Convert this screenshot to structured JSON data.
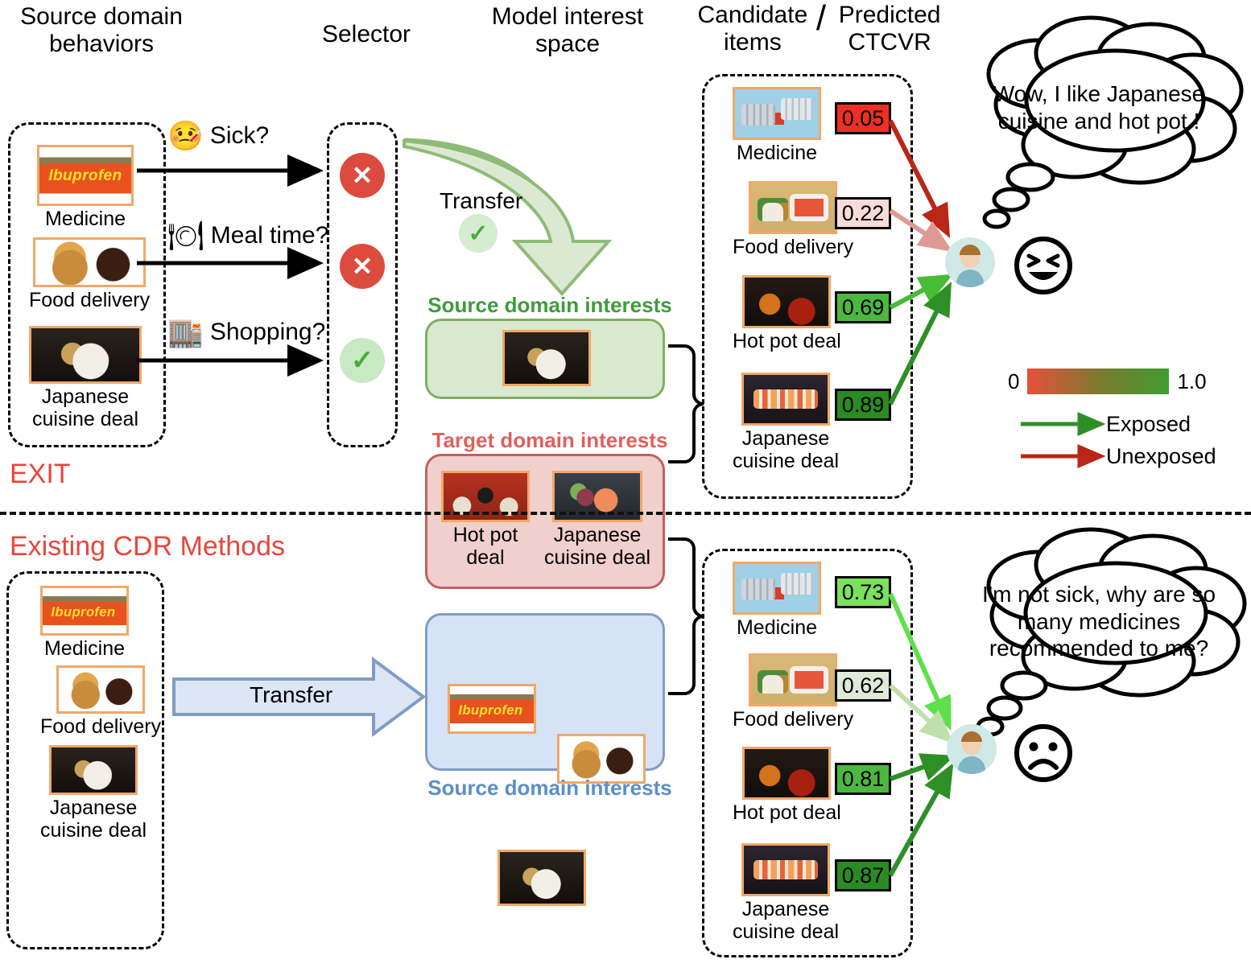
{
  "headers": {
    "source_behaviors": "Source domain\nbehaviors",
    "selector": "Selector",
    "model_interest_space": "Model interest\nspace",
    "candidate_ctcvr": "Candidate  /  Predicted\nitems         CTCVR",
    "candidate_line1": "Candidate",
    "candidate_line2": "items",
    "predicted_line1": "Predicted",
    "predicted_line2": "CTCVR"
  },
  "sections": {
    "top_label": "EXIT",
    "bottom_label": "Existing CDR Methods"
  },
  "top": {
    "behaviors": [
      {
        "label": "Medicine",
        "image": "medicine-box"
      },
      {
        "label": "Food delivery",
        "image": "burger-and-soda"
      },
      {
        "label": "Japanese\ncuisine deal",
        "image": "sashimi-plate"
      }
    ],
    "behavior_labels": [
      "Medicine",
      "Food delivery",
      "Japanese",
      "cuisine deal"
    ],
    "selector": {
      "questions": [
        {
          "text": "Sick?",
          "icon": "sick-person-icon",
          "decision": "reject"
        },
        {
          "text": "Meal time?",
          "icon": "person-eating-icon",
          "decision": "reject"
        },
        {
          "text": "Shopping?",
          "icon": "mall-building-icon",
          "decision": "accept"
        }
      ],
      "reject_symbol": "✕",
      "accept_symbol": "✓"
    },
    "transfer": {
      "label": "Transfer",
      "status": "accept",
      "symbol": "✓"
    },
    "source_interests": {
      "title": "Source domain interests",
      "color": "#3f9c3a",
      "items": [
        {
          "label": "",
          "image": "sashimi-plate"
        }
      ]
    },
    "target_interests": {
      "title": "Target domain interests",
      "color": "#e0605e",
      "items": [
        {
          "label": "Hot pot\ndeal",
          "image": "hotpot-spread"
        },
        {
          "label": "Japanese\ncuisine deal",
          "image": "sashimi-platter"
        }
      ],
      "labels": [
        "Hot pot",
        "deal",
        "Japanese",
        "cuisine deal"
      ]
    },
    "candidates": [
      {
        "label": "Medicine",
        "image": "pills-tray",
        "score": "0.05",
        "chip_bg": "#ee2f22",
        "arrow": "unexposed",
        "arrow_color": "#b92717"
      },
      {
        "label": "Food delivery",
        "image": "bento-box",
        "score": "0.22",
        "chip_bg": "#f7dbd8",
        "arrow": "unexposed",
        "arrow_color": "#dd9a94"
      },
      {
        "label": "Hot pot deal",
        "image": "hotpot-dish",
        "score": "0.69",
        "chip_bg": "#4cb83f",
        "arrow": "exposed",
        "arrow_color": "#49bb36"
      },
      {
        "label": "Japanese\ncuisine deal",
        "image": "sushi-platter",
        "score": "0.89",
        "chip_bg": "#2a8b22",
        "arrow": "exposed",
        "arrow_color": "#2f8f27"
      }
    ],
    "candidate_labels": [
      "Medicine",
      "Food delivery",
      "Hot pot deal",
      "Japanese",
      "cuisine deal"
    ],
    "thought": "Wow, I like Japanese cuisine and hot pot !",
    "thought_lines": [
      "Wow, I like Japanese",
      "cuisine and hot pot !"
    ],
    "user_icon": "user-avatar",
    "emoji": "happy-face"
  },
  "bottom": {
    "behaviors": [
      {
        "label": "Medicine",
        "image": "medicine-box"
      },
      {
        "label": "Food delivery",
        "image": "burger-and-soda"
      },
      {
        "label": "Japanese\ncuisine deal",
        "image": "sashimi-plate"
      }
    ],
    "behavior_labels": [
      "Medicine",
      "Food delivery",
      "Japanese",
      "cuisine deal"
    ],
    "transfer": {
      "label": "Transfer"
    },
    "source_interests": {
      "title": "Source domain interests",
      "color": "#5b8ec9",
      "items": [
        {
          "image": "medicine-box"
        },
        {
          "image": "burger-and-soda"
        },
        {
          "image": "sashimi-plate"
        }
      ]
    },
    "candidates": [
      {
        "label": "Medicine",
        "image": "pills-tray",
        "score": "0.73",
        "chip_bg": "#7ae05e",
        "arrow": "exposed",
        "arrow_color": "#5fe04a"
      },
      {
        "label": "Food delivery",
        "image": "bento-box",
        "score": "0.62",
        "chip_bg": "#dfe9d8",
        "arrow": "exposed",
        "arrow_color": "#bfe0ad"
      },
      {
        "label": "Hot pot deal",
        "image": "hotpot-dish",
        "score": "0.81",
        "chip_bg": "#4cb83f",
        "arrow": "exposed",
        "arrow_color": "#2f8f27"
      },
      {
        "label": "Japanese\ncuisine deal",
        "image": "sushi-platter",
        "score": "0.87",
        "chip_bg": "#2a8b22",
        "arrow": "exposed",
        "arrow_color": "#2f8f27"
      }
    ],
    "candidate_labels": [
      "Medicine",
      "Food delivery",
      "Hot pot deal",
      "Japanese",
      "cuisine deal"
    ],
    "thought": "I'm not sick, why are so many medicines recommended to me?",
    "thought_lines": [
      "I'm not sick, why are so",
      "many medicines",
      "recommended to me?"
    ],
    "user_icon": "user-avatar",
    "emoji": "sad-face"
  },
  "legend": {
    "scale_min": "0",
    "scale_max": "1.0",
    "gradient_from": "#e8503c",
    "gradient_to": "#3f9c2f",
    "exposed_label": "Exposed",
    "exposed_color": "#2f8f27",
    "unexposed_label": "Unexposed",
    "unexposed_color": "#b92717"
  }
}
